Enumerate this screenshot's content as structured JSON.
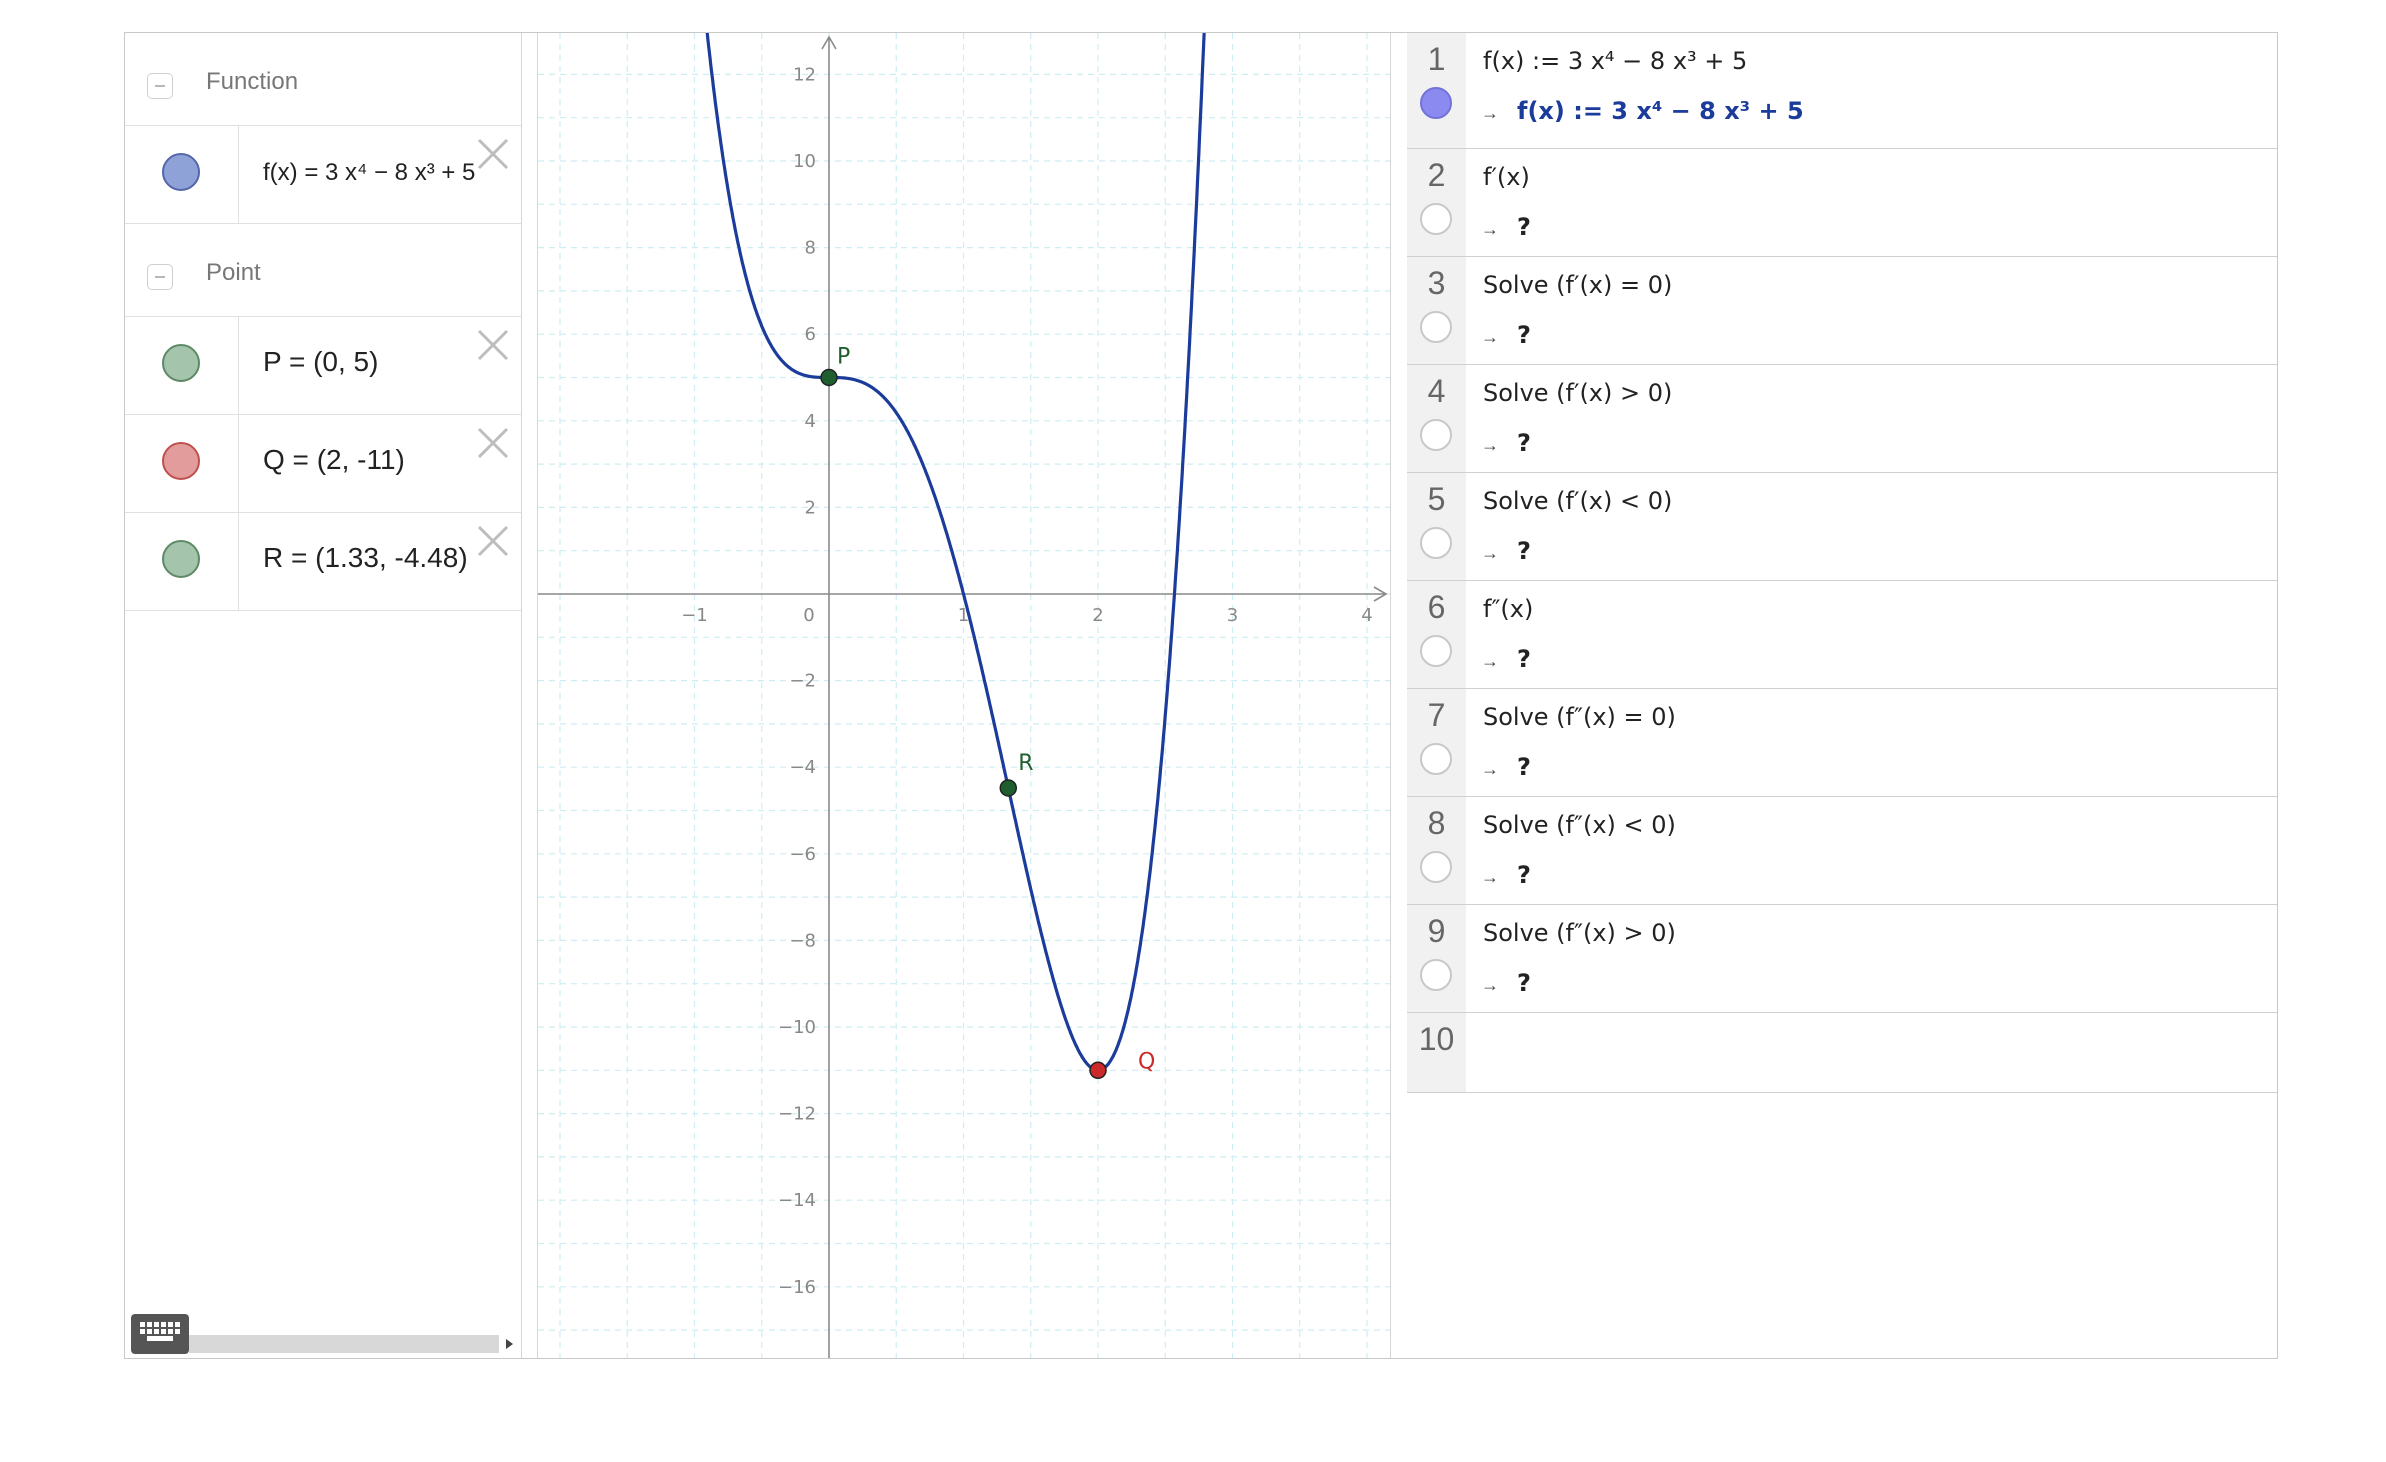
{
  "algebra": {
    "categories": [
      {
        "label": "Function"
      },
      {
        "label": "Point"
      }
    ],
    "items": [
      {
        "text": "f(x)  =  3 x⁴ − 8 x³ + 5",
        "color": "#8fa2d8",
        "border": "#5566aa"
      },
      {
        "text": "P = (0, 5)",
        "color": "#a4c4ac",
        "border": "#5e8a66"
      },
      {
        "text": "Q = (2, -11)",
        "color": "#e39c9c",
        "border": "#c0504d"
      },
      {
        "text": "R = (1.33, -4.48)",
        "color": "#a4c4ac",
        "border": "#5e8a66"
      }
    ]
  },
  "graph": {
    "x_ticks": [
      -1,
      0,
      1,
      2,
      3,
      4
    ],
    "y_ticks": [
      12,
      10,
      8,
      6,
      4,
      2,
      -2,
      -4,
      -6,
      -8,
      -10,
      -12,
      -14,
      -16
    ],
    "curve_color": "#1c3c9c",
    "points": [
      {
        "label": "P",
        "x": 0,
        "y": 5,
        "color": "#1f5f2f"
      },
      {
        "label": "R",
        "x": 1.333,
        "y": -4.48,
        "color": "#1f5f2f"
      },
      {
        "label": "Q",
        "x": 2,
        "y": -11,
        "color": "#cc2a2a"
      }
    ]
  },
  "cas": {
    "rows": [
      {
        "num": "1",
        "input": "f(x) := 3 x⁴ − 8 x³ + 5",
        "output": "f(x)  :=  3 x⁴ − 8 x³ + 5",
        "arrow": "→",
        "active": true
      },
      {
        "num": "2",
        "input": "f′(x)",
        "output": "?",
        "arrow": "→",
        "active": false
      },
      {
        "num": "3",
        "input": "Solve (f′(x) = 0)",
        "output": "?",
        "arrow": "→",
        "active": false
      },
      {
        "num": "4",
        "input": "Solve (f′(x) > 0)",
        "output": "?",
        "arrow": "→",
        "active": false
      },
      {
        "num": "5",
        "input": "Solve (f′(x) < 0)",
        "output": "?",
        "arrow": "→",
        "active": false
      },
      {
        "num": "6",
        "input": "f″(x)",
        "output": "?",
        "arrow": "→",
        "active": false
      },
      {
        "num": "7",
        "input": "Solve (f″(x) = 0)",
        "output": "?",
        "arrow": "→",
        "active": false
      },
      {
        "num": "8",
        "input": "Solve (f″(x) < 0)",
        "output": "?",
        "arrow": "→",
        "active": false
      },
      {
        "num": "9",
        "input": "Solve (f″(x) > 0)",
        "output": "?",
        "arrow": "→",
        "active": false
      },
      {
        "num": "10",
        "input": "",
        "output": "",
        "arrow": "",
        "active": false
      }
    ]
  }
}
